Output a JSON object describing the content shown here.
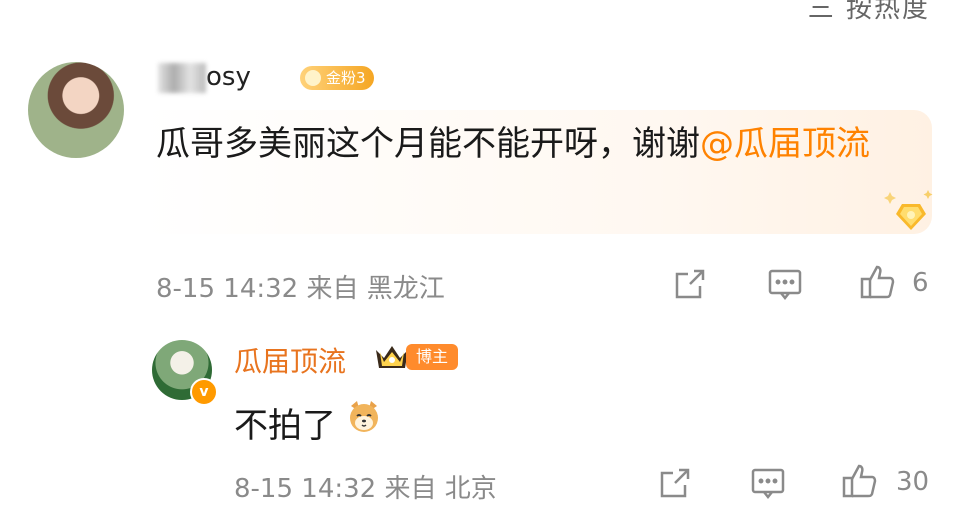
{
  "top_sort_label": "三 按热度",
  "comment": {
    "username_visible": "osy",
    "fan_badge": "金粉3",
    "text": "瓜哥多美丽这个月能不能开呀，谢谢",
    "mention": "@瓜届顶流",
    "date": "8-15 14:32",
    "source": "来自 黑龙江",
    "like_count": "6"
  },
  "reply": {
    "username": "瓜届顶流",
    "host_badge": "博主",
    "text": "不拍了",
    "date": "8-15 14:32",
    "source": "来自 北京",
    "like_count": "30"
  },
  "icons": {
    "share": "share-icon",
    "comment": "comment-icon",
    "like": "like-icon",
    "crown": "crown-icon",
    "verified": "verified-icon",
    "dog": "dog-emoji-icon"
  },
  "colors": {
    "accent": "#ff8200",
    "meta": "#8a8a8a",
    "username_reply": "#e8741f"
  }
}
